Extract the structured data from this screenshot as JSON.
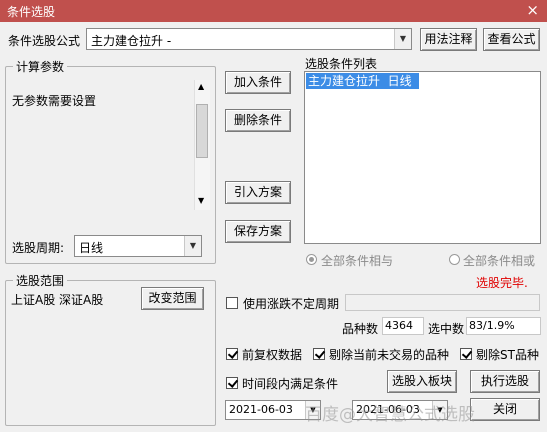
{
  "window": {
    "title": "条件选股",
    "close_glyph": "×"
  },
  "formula": {
    "label": "条件选股公式",
    "value": "主力建仓拉升 -",
    "usage_btn": "用法注释",
    "view_btn": "查看公式"
  },
  "params": {
    "group_label": "计算参数",
    "text": "无参数需要设置"
  },
  "period": {
    "label": "选股周期:",
    "value": "日线"
  },
  "range": {
    "group_label": "选股范围",
    "text": "上证A股 深证A股",
    "change_btn": "改变范围"
  },
  "actions": {
    "add": "加入条件",
    "delete": "删除条件",
    "import": "引入方案",
    "save": "保存方案"
  },
  "condlist": {
    "label": "选股条件列表",
    "items": [
      {
        "name": "主力建仓拉升",
        "period": "日线"
      }
    ]
  },
  "logic": {
    "all_and": "全部条件相与",
    "all_or": "全部条件相或",
    "status": "选股完毕."
  },
  "float_period": {
    "label": "使用涨跌不定周期"
  },
  "stats": {
    "count_label": "品种数",
    "count_value": "4364",
    "selected_label": "选中数",
    "selected_value": "83/1.9%"
  },
  "options": {
    "pre_adjust": "前复权数据",
    "exclude_untraded": "剔除当前未交易的品种",
    "exclude_st": "剔除ST品种",
    "time_range": "时间段内满足条件"
  },
  "dates": {
    "start": "2021-06-03",
    "end": "2021-06-03"
  },
  "buttons": {
    "add_to_block": "选股入板块",
    "run": "执行选股",
    "close": "关闭"
  },
  "watermark": "百度@大智慧公式选股",
  "colors": {
    "titlebar": "#c0504d",
    "selection": "#3c8ce6",
    "status": "#e00000"
  }
}
